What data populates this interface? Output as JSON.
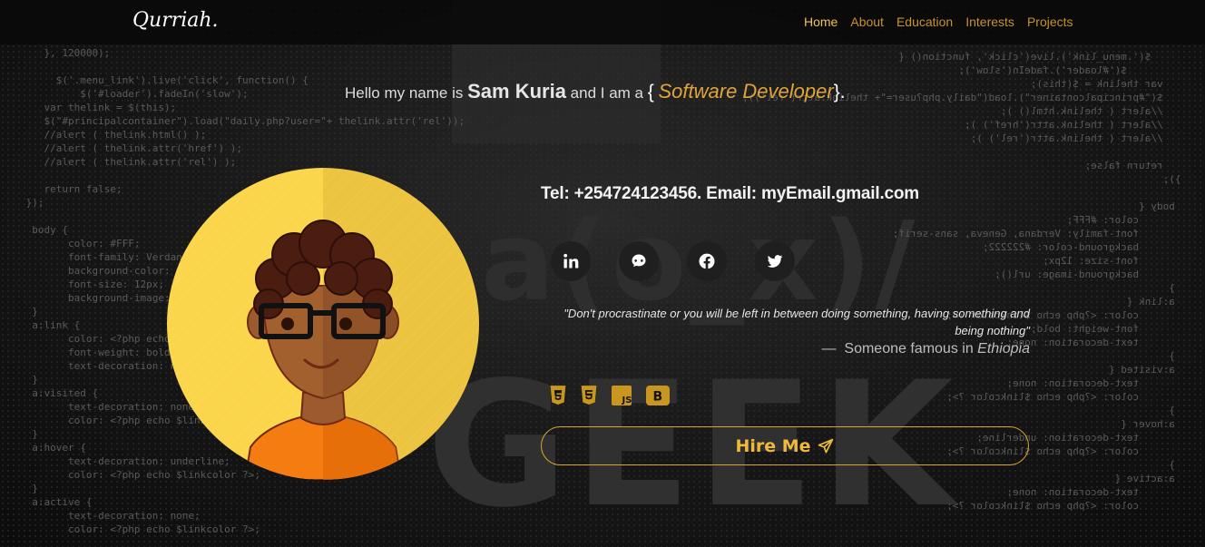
{
  "nav": {
    "brand": "Qurriah.",
    "links": [
      "Home",
      "About",
      "Education",
      "Interests",
      "Projects"
    ],
    "active": "Home"
  },
  "hero": {
    "greeting_prefix": "Hello my name is",
    "name": "Sam Kuria",
    "greeting_middle": "and I am a",
    "brace_open": "{",
    "role": "Software Developer",
    "brace_close": "}."
  },
  "contact": {
    "line": "Tel: +254724123456. Email: myEmail.gmail.com"
  },
  "socials": [
    {
      "name": "linkedin-icon"
    },
    {
      "name": "github-icon"
    },
    {
      "name": "facebook-icon"
    },
    {
      "name": "twitter-icon"
    }
  ],
  "quote": {
    "text": "\"Don't procrastinate or you will be left in between doing something, having something and being nothing\"",
    "dash": "—",
    "author_prefix": "Someone famous in",
    "author_place": "Ethiopia"
  },
  "tech_icons": [
    "css3-icon",
    "html5-icon",
    "js-icon",
    "bootstrap-icon"
  ],
  "tech_labels": {
    "js": "JS",
    "bootstrap": "B"
  },
  "hire": {
    "label": "Hire Me"
  },
  "colors": {
    "accent": "#e0a53a",
    "nav_link": "#c9922a",
    "nav_active": "#f2c14e",
    "avatar_bg": "#fbd54a"
  }
}
